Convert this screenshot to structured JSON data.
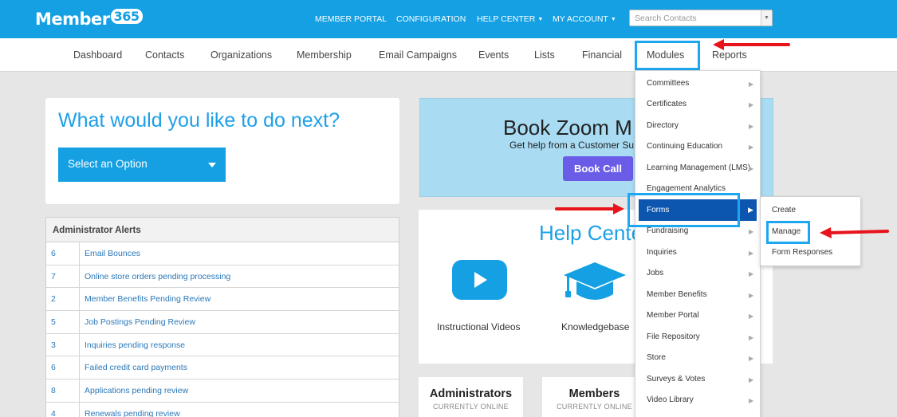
{
  "header": {
    "logo_text": "Member",
    "logo_num": "365",
    "nav": [
      {
        "label": "MEMBER PORTAL"
      },
      {
        "label": "CONFIGURATION"
      },
      {
        "label": "HELP CENTER"
      },
      {
        "label": "MY ACCOUNT"
      }
    ],
    "search_placeholder": "Search Contacts"
  },
  "subnav": {
    "items": [
      "Dashboard",
      "Contacts",
      "Organizations",
      "Membership",
      "Email Campaigns",
      "Events",
      "Lists",
      "Financial",
      "Modules",
      "Reports"
    ]
  },
  "next": {
    "title": "What would you like to do next?",
    "select_label": "Select an Option"
  },
  "alerts": {
    "title": "Administrator Alerts",
    "rows": [
      {
        "count": "6",
        "text": "Email Bounces"
      },
      {
        "count": "7",
        "text": "Online store orders pending processing"
      },
      {
        "count": "2",
        "text": "Member Benefits Pending Review"
      },
      {
        "count": "5",
        "text": "Job Postings Pending Review"
      },
      {
        "count": "3",
        "text": "Inquiries pending response"
      },
      {
        "count": "6",
        "text": "Failed credit card payments"
      },
      {
        "count": "8",
        "text": "Applications pending review"
      },
      {
        "count": "4",
        "text": "Renewals pending review"
      }
    ]
  },
  "zoom": {
    "title": "Book Zoom M",
    "subtitle": "Get help from a Customer Su",
    "button": "Book Call"
  },
  "help": {
    "title": "Help Cente",
    "videos_label": "Instructional Videos",
    "kb_label": "Knowledgebase"
  },
  "stats": {
    "admins_title": "Administrators",
    "members_title": "Members",
    "online_label": "CURRENTLY ONLINE"
  },
  "modules_menu": {
    "items": [
      "Committees",
      "Certificates",
      "Directory",
      "Continuing Education",
      "Learning Management (LMS)",
      "Engagement Analytics",
      "Forms",
      "Fundraising",
      "Inquiries",
      "Jobs",
      "Member Benefits",
      "Member Portal",
      "File Repository",
      "Store",
      "Surveys & Votes",
      "Video Library"
    ],
    "active": "Forms"
  },
  "forms_submenu": {
    "items": [
      "Create",
      "Manage",
      "Form Responses"
    ]
  },
  "colors": {
    "brand_blue": "#14a0e3",
    "highlight_blue": "#1ea7f1",
    "active_menu": "#0d56b0",
    "annotation_red": "#e8141b",
    "zoom_button": "#6b5ce7"
  }
}
